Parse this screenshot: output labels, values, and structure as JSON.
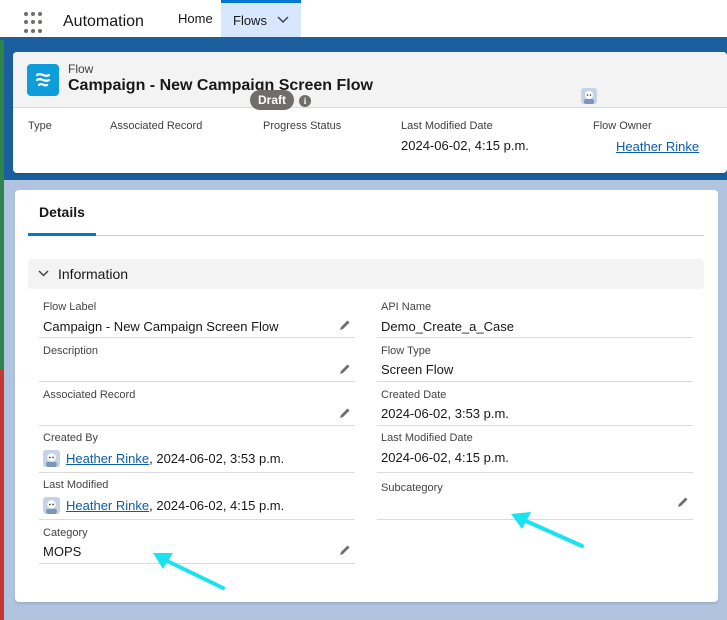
{
  "nav": {
    "app_name": "Automation",
    "tabs": [
      {
        "label": "Home"
      },
      {
        "label": "Flows"
      }
    ]
  },
  "header": {
    "record_type": "Flow",
    "title": "Campaign - New Campaign Screen Flow",
    "highlights": {
      "type_label": "Type",
      "associated_record_label": "Associated Record",
      "progress_status_label": "Progress Status",
      "progress_status_value": "Draft",
      "last_modified_label": "Last Modified Date",
      "last_modified_value": "2024-06-02, 4:15 p.m.",
      "owner_label": "Flow Owner",
      "owner_value": "Heather Rinke"
    }
  },
  "detail": {
    "tab_label": "Details",
    "section_title": "Information",
    "fields": {
      "flow_label": {
        "label": "Flow Label",
        "value": "Campaign - New Campaign Screen Flow"
      },
      "api_name": {
        "label": "API Name",
        "value": "Demo_Create_a_Case"
      },
      "description": {
        "label": "Description",
        "value": ""
      },
      "flow_type": {
        "label": "Flow Type",
        "value": "Screen Flow"
      },
      "associated_record": {
        "label": "Associated Record",
        "value": ""
      },
      "created_date": {
        "label": "Created Date",
        "value": "2024-06-02, 3:53 p.m."
      },
      "created_by": {
        "label": "Created By",
        "user": "Heather Rinke",
        "suffix": ", 2024-06-02, 3:53 p.m."
      },
      "last_modified_date": {
        "label": "Last Modified Date",
        "value": "2024-06-02, 4:15 p.m."
      },
      "last_modified": {
        "label": "Last Modified",
        "user": "Heather Rinke",
        "suffix": ", 2024-06-02, 4:15 p.m."
      },
      "subcategory": {
        "label": "Subcategory",
        "value": ""
      },
      "category": {
        "label": "Category",
        "value": "MOPS"
      }
    }
  },
  "colors": {
    "brand_blue": "#0176d3",
    "nav_band": "#1b5f9e",
    "icon_teal": "#0d9dda",
    "annotation_arrow": "#19e3f0"
  }
}
